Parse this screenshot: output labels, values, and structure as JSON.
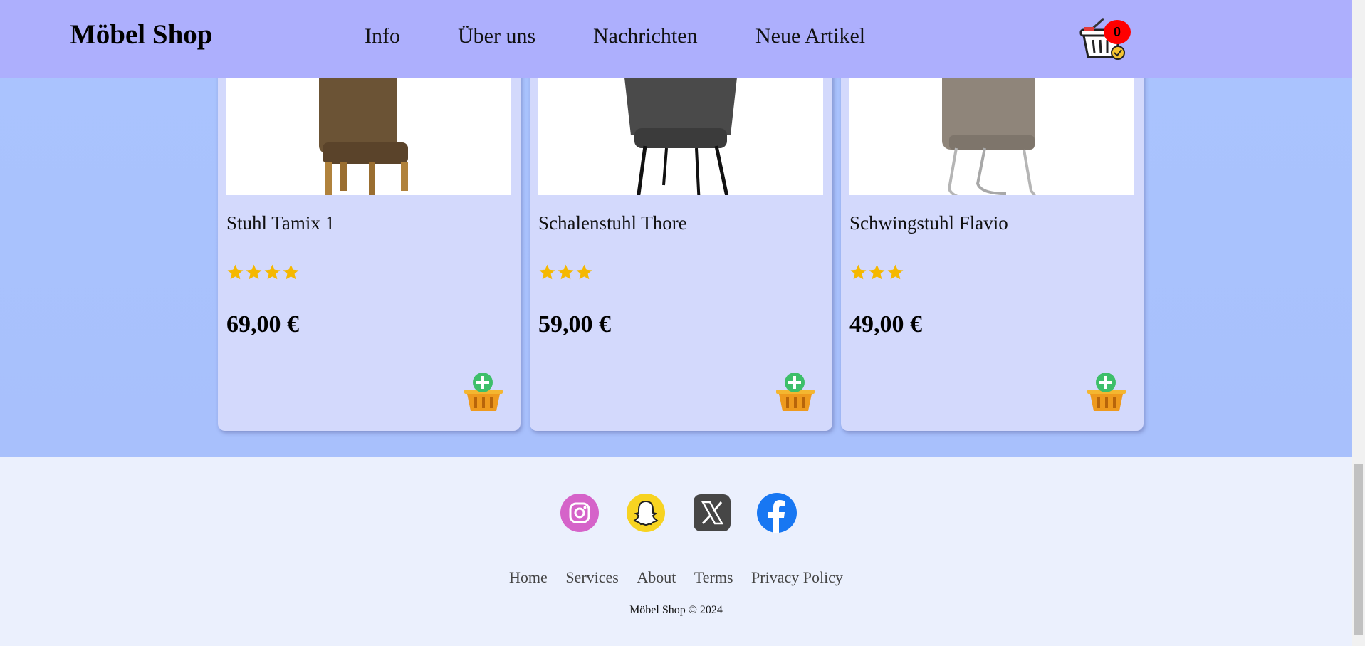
{
  "header": {
    "brand": "Möbel Shop",
    "nav": [
      {
        "label": "Info"
      },
      {
        "label": "Über uns"
      },
      {
        "label": "Nachrichten"
      },
      {
        "label": "Neue Artikel"
      }
    ],
    "cart_count": "0"
  },
  "products": [
    {
      "name": "Stuhl Tamix 1",
      "rating": 4,
      "price": "69,00 €",
      "color": "#6b5335"
    },
    {
      "name": "Schalenstuhl Thore",
      "rating": 3,
      "price": "59,00 €",
      "color": "#4a4a4a"
    },
    {
      "name": "Schwingstuhl Flavio",
      "rating": 3,
      "price": "49,00 €",
      "color": "#8f857a"
    }
  ],
  "footer": {
    "social": [
      {
        "icon": "instagram-icon",
        "color": "#d563c9"
      },
      {
        "icon": "snapchat-icon",
        "color": "#f7d321"
      },
      {
        "icon": "x-icon",
        "color": "#464646"
      },
      {
        "icon": "facebook-icon",
        "color": "#1877f2"
      }
    ],
    "links": [
      "Home",
      "Services",
      "About",
      "Terms",
      "Privacy Policy"
    ],
    "copyright": "Möbel Shop © 2024"
  },
  "colors": {
    "star": "#f5b800",
    "badge": "#ff0000",
    "nav_bg": "#adaffd"
  }
}
